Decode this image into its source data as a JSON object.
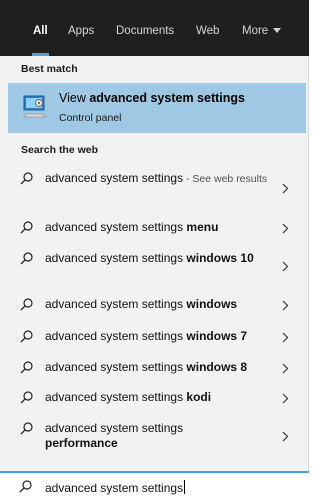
{
  "tabs": [
    {
      "label": "All",
      "active": true
    },
    {
      "label": "Apps"
    },
    {
      "label": "Documents"
    },
    {
      "label": "Web"
    },
    {
      "label": "More"
    }
  ],
  "best_match": {
    "header": "Best match",
    "title_prefix": "View ",
    "title_bold": "advanced system settings",
    "subtitle": "Control panel",
    "icon": "system-settings-icon"
  },
  "web": {
    "header": "Search the web",
    "items": [
      {
        "text": "advanced system settings",
        "suffix": " - See web results",
        "bold": ""
      },
      {
        "text": "advanced system settings ",
        "bold": "menu"
      },
      {
        "text": "advanced system settings ",
        "bold": "windows 10"
      },
      {
        "text": "advanced system settings ",
        "bold": "windows"
      },
      {
        "text": "advanced system settings ",
        "bold": "windows 7"
      },
      {
        "text": "advanced system settings ",
        "bold": "windows 8"
      },
      {
        "text": "advanced system settings ",
        "bold": "kodi"
      },
      {
        "text": "advanced system settings ",
        "bold": "performance"
      }
    ]
  },
  "search": {
    "value": "advanced system settings",
    "icon": "search-icon"
  },
  "colors": {
    "topbar": "#1f1f1f",
    "accent": "#4aa3e0",
    "highlight": "#9ec8e4",
    "panel": "#f2f2f2"
  }
}
